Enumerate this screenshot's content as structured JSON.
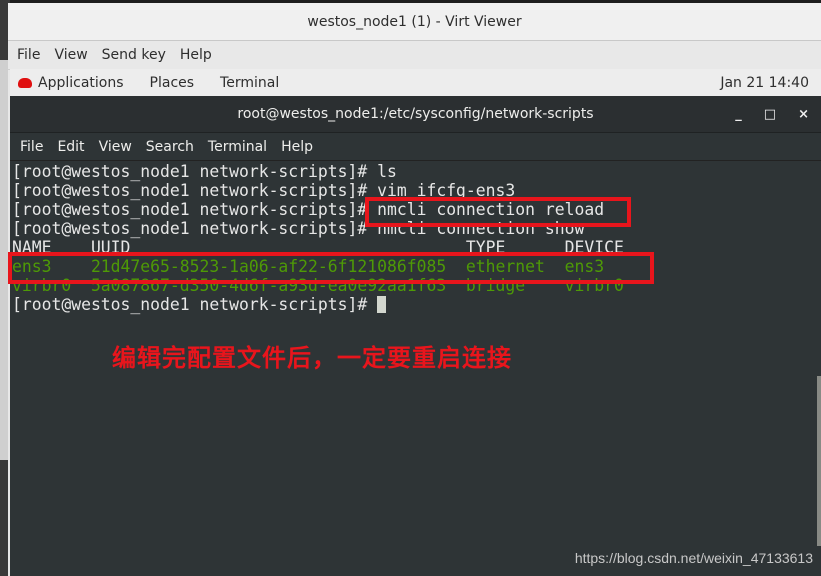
{
  "viewer": {
    "title": "westos_node1 (1) - Virt Viewer",
    "menu": [
      "File",
      "View",
      "Send key",
      "Help"
    ]
  },
  "panel": {
    "items": [
      "Applications",
      "Places",
      "Terminal"
    ],
    "clock": "Jan 21 14:40"
  },
  "terminal": {
    "title": "root@westos_node1:/etc/sysconfig/network-scripts",
    "window_buttons": [
      "_",
      "□",
      "×"
    ],
    "menu": [
      "File",
      "Edit",
      "View",
      "Search",
      "Terminal",
      "Help"
    ],
    "lines": [
      "[root@westos_node1 network-scripts]# ls",
      "[root@westos_node1 network-scripts]# vim ifcfg-ens3",
      "[root@westos_node1 network-scripts]# nmcli connection reload",
      "[root@westos_node1 network-scripts]# nmcli connection show",
      "NAME    UUID                                  TYPE      DEVICE "
    ],
    "green_lines": [
      "ens3    21d47e65-8523-1a06-af22-6f121086f085  ethernet  ens3   ",
      "virbr0  5a087867-d350-4d6f-a93d-ea0e92aa1f63  bridge    virbr0 "
    ],
    "prompt": "[root@westos_node1 network-scripts]# "
  },
  "annotation": "编辑完配置文件后，一定要重启连接",
  "watermark": "https://blog.csdn.net/weixin_47133613",
  "colors": {
    "highlight_box": "#e8151c",
    "terminal_bg": "#2e3436",
    "green": "#4e9a06"
  }
}
